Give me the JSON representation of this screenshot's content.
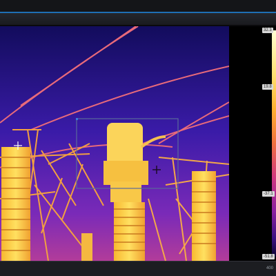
{
  "temperature_scale": {
    "max_label": "32.3",
    "upper_label": "19.8",
    "lower_label": "-37.1",
    "min_label": "-51.8"
  },
  "status_bar": {
    "right_text": "400"
  },
  "colors": {
    "palette": "ironbow",
    "accent": "#1f6fb4",
    "roi_outline": "#5a6a9a"
  }
}
